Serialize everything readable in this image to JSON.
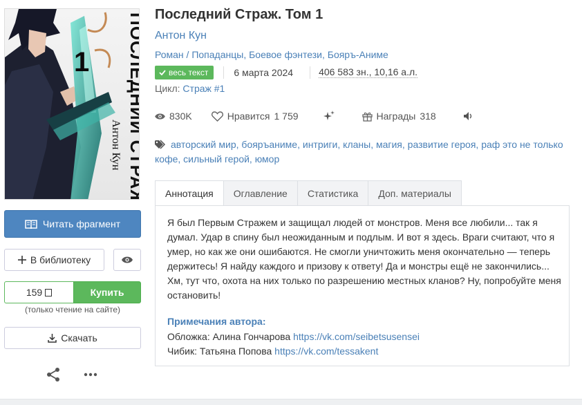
{
  "book": {
    "title": "Последний Страж. Том 1",
    "author": "Антон Кун",
    "genres": [
      "Роман",
      "Попаданцы",
      "Боевое фэнтези",
      "Бояръ-Аниме"
    ],
    "badge": "весь текст",
    "date": "6 марта 2024",
    "size": "406 583 зн., 10,16 а.л.",
    "cycle_label": "Цикл:",
    "cycle_name": "Страж #1"
  },
  "cover": {
    "title_art": "ПОСЛЕДНИЙ СТРАЖ",
    "author_art": "Антон Кун",
    "volume": "1"
  },
  "stats": {
    "views": "830K",
    "likes_label": "Нравится",
    "likes": "1 759",
    "awards_label": "Награды",
    "awards": "318"
  },
  "tags": [
    "авторский мир",
    "бояръаниме",
    "интриги",
    "кланы",
    "магия",
    "развитие героя",
    "раф это не только кофе",
    "сильный герой",
    "юмор"
  ],
  "tabs": [
    "Аннотация",
    "Оглавление",
    "Статистика",
    "Доп. материалы"
  ],
  "annotation": "Я был Первым Стражем и защищал людей от монстров. Меня все любили... так я думал. Удар в спину был неожиданным и подлым. И вот я здесь. Враги считают, что я умер, но как же они ошибаются. Не смогли уничтожить меня окончательно — теперь держитесь! Я найду каждого и призову к ответу! Да и монстры ещё не закончились... Хм, тут что, охота на них только по разрешению местных кланов? Ну, попробуйте меня остановить!",
  "notes": {
    "title": "Примечания автора:",
    "cover_label": "Обложка: Алина Гончарова",
    "cover_link": "https://vk.com/seibetsusensei",
    "chibi_label": "Чибик: Татьяна Попова",
    "chibi_link": "https://vk.com/tessakent"
  },
  "actions": {
    "read_fragment": "Читать фрагмент",
    "to_library": "В библиотеку",
    "price": "159",
    "buy": "Купить",
    "read_note": "(только чтение на сайте)",
    "download": "Скачать"
  },
  "colors": {
    "link": "#4a80b7",
    "primary": "#4e86c0",
    "success": "#5cb85c"
  }
}
